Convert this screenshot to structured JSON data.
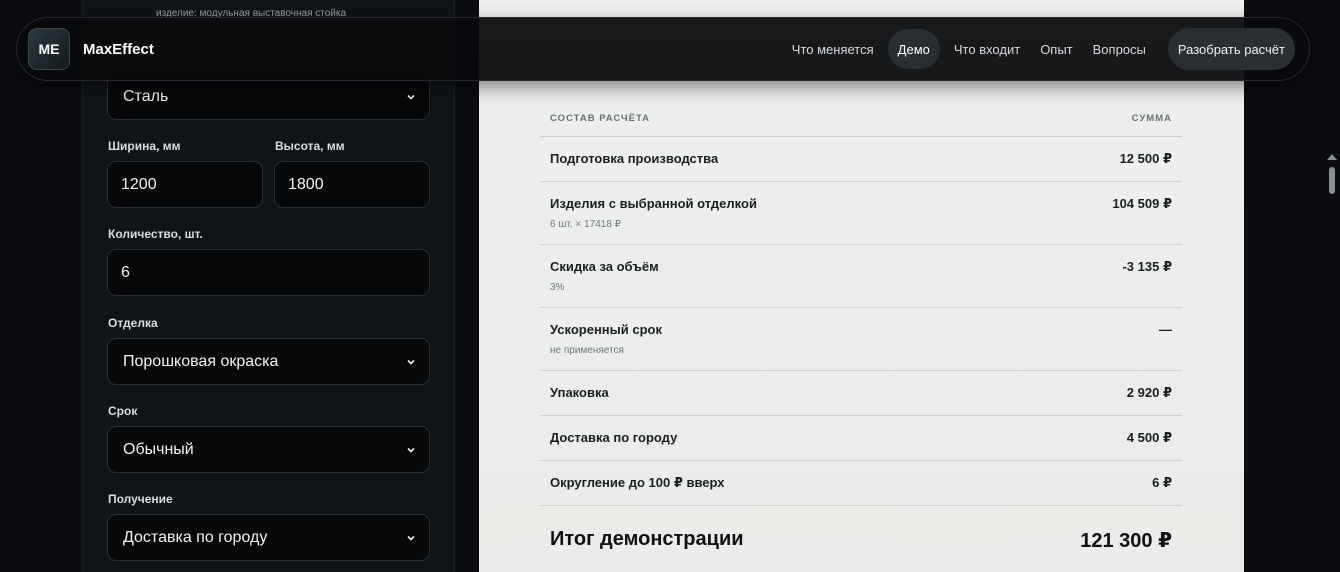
{
  "header": {
    "logo": "ME",
    "brand": "MaxEffect",
    "nav": [
      "Что меняется",
      "Демо",
      "Что входит",
      "Опыт",
      "Вопросы"
    ],
    "active_nav": "Демо",
    "cta": "Разобрать расчёт"
  },
  "form": {
    "caption": "изделие: модульная выставочная стойка",
    "material_value": "Сталь",
    "width_label": "Ширина, мм",
    "width_value": "1200",
    "height_label": "Высота, мм",
    "height_value": "1800",
    "qty_label": "Количество, шт.",
    "qty_value": "6",
    "finish_label": "Отделка",
    "finish_value": "Порошковая окраска",
    "term_label": "Срок",
    "term_value": "Обычный",
    "delivery_label": "Получение",
    "delivery_value": "Доставка по городу"
  },
  "summary": {
    "col_left": "СОСТАВ РАСЧЁТА",
    "col_right": "СУММА",
    "rows": [
      {
        "label": "Подготовка производства",
        "sub": "",
        "amount": "12 500 ₽"
      },
      {
        "label": "Изделия с выбранной отделкой",
        "sub": "6 шт. × 17418 ₽",
        "amount": "104 509 ₽"
      },
      {
        "label": "Скидка за объём",
        "sub": "3%",
        "amount": "-3 135 ₽"
      },
      {
        "label": "Ускоренный срок",
        "sub": "не применяется",
        "amount": "—"
      },
      {
        "label": "Упаковка",
        "sub": "",
        "amount": "2 920 ₽"
      },
      {
        "label": "Доставка по городу",
        "sub": "",
        "amount": "4 500 ₽"
      },
      {
        "label": "Округление до 100 ₽ вверх",
        "sub": "",
        "amount": "6 ₽"
      }
    ],
    "total_label": "Итог демонстрации",
    "total_amount": "121 300 ₽"
  }
}
